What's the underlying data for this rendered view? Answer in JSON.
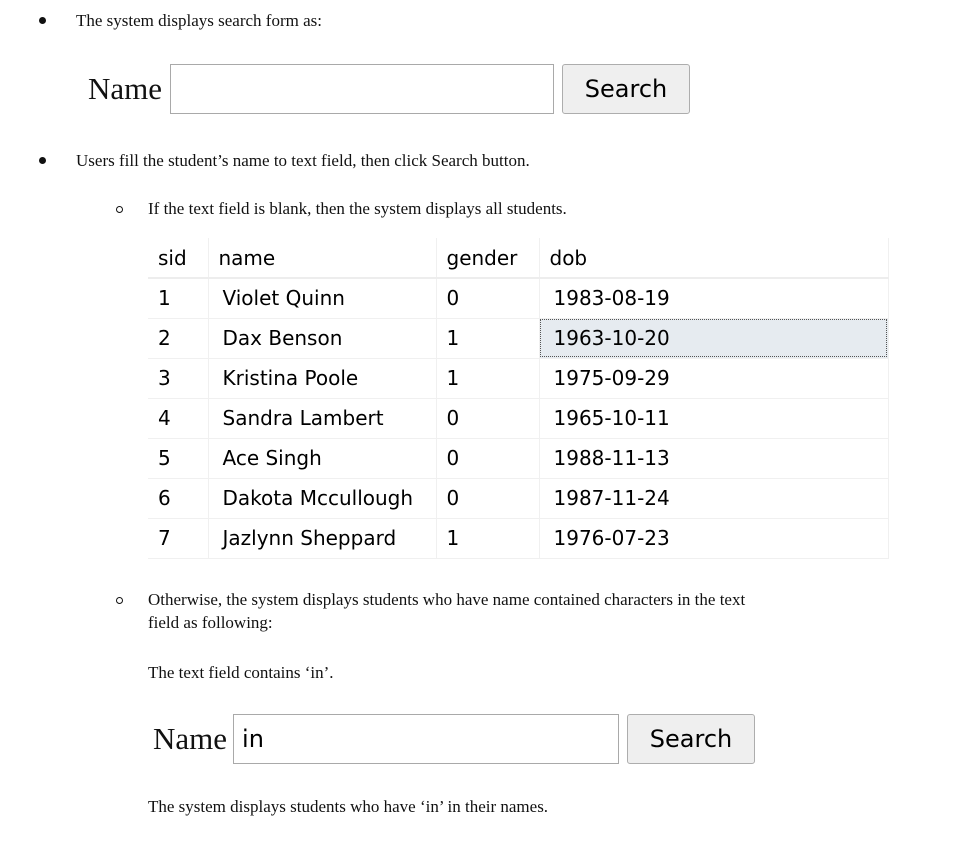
{
  "intro": {
    "text": "The system displays search form as:"
  },
  "form1": {
    "label": "Name",
    "value": "",
    "button": "Search"
  },
  "step": {
    "text": "Users fill the student’s name to text field, then click Search button."
  },
  "case_blank": {
    "text": "If the text field is blank, then the system displays all students."
  },
  "table": {
    "headers": [
      "sid",
      "name",
      "gender",
      "dob"
    ],
    "rows": [
      [
        "1",
        "Violet Quinn",
        "0",
        "1983-08-19"
      ],
      [
        "2",
        "Dax Benson",
        "1",
        "1963-10-20"
      ],
      [
        "3",
        "Kristina Poole",
        "1",
        "1975-09-29"
      ],
      [
        "4",
        "Sandra Lambert",
        "0",
        "1965-10-11"
      ],
      [
        "5",
        "Ace Singh",
        "0",
        "1988-11-13"
      ],
      [
        "6",
        "Dakota Mccullough",
        "0",
        "1987-11-24"
      ],
      [
        "7",
        "Jazlynn Sheppard",
        "1",
        "1976-07-23"
      ]
    ]
  },
  "case_other": {
    "line1": "Otherwise, the system displays students who have name contained characters in the text",
    "line2": "field as following:"
  },
  "contains_note": {
    "text": "The text field contains ‘in’."
  },
  "form2": {
    "label": "Name",
    "value": "in",
    "button": "Search"
  },
  "result_note": {
    "text": "The system displays students who have ‘in’ in their names."
  }
}
